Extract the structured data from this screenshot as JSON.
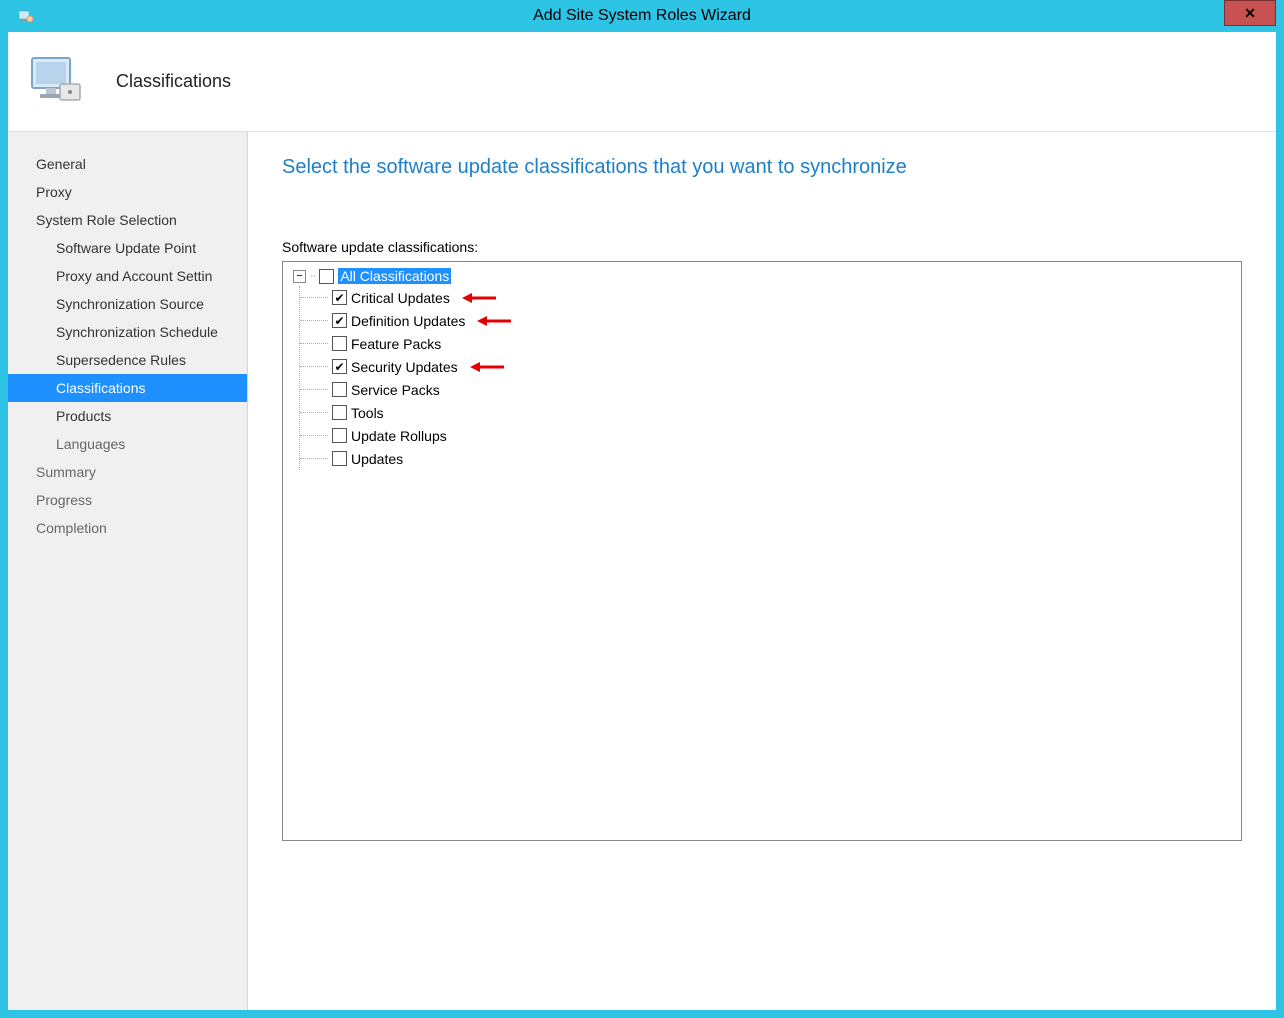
{
  "window": {
    "title": "Add Site System Roles Wizard"
  },
  "header": {
    "title": "Classifications"
  },
  "sidebar": {
    "items": [
      {
        "label": "General",
        "level": 0,
        "selected": false,
        "inactive": false
      },
      {
        "label": "Proxy",
        "level": 0,
        "selected": false,
        "inactive": false
      },
      {
        "label": "System Role Selection",
        "level": 0,
        "selected": false,
        "inactive": false
      },
      {
        "label": "Software Update Point",
        "level": 1,
        "selected": false,
        "inactive": false
      },
      {
        "label": "Proxy and Account Settin",
        "level": 1,
        "selected": false,
        "inactive": false
      },
      {
        "label": "Synchronization Source",
        "level": 1,
        "selected": false,
        "inactive": false
      },
      {
        "label": "Synchronization Schedule",
        "level": 1,
        "selected": false,
        "inactive": false
      },
      {
        "label": "Supersedence Rules",
        "level": 1,
        "selected": false,
        "inactive": false
      },
      {
        "label": "Classifications",
        "level": 1,
        "selected": true,
        "inactive": false
      },
      {
        "label": "Products",
        "level": 1,
        "selected": false,
        "inactive": false
      },
      {
        "label": "Languages",
        "level": 1,
        "selected": false,
        "inactive": true
      },
      {
        "label": "Summary",
        "level": 0,
        "selected": false,
        "inactive": true
      },
      {
        "label": "Progress",
        "level": 0,
        "selected": false,
        "inactive": true
      },
      {
        "label": "Completion",
        "level": 0,
        "selected": false,
        "inactive": true
      }
    ]
  },
  "main": {
    "heading": "Select the software update classifications that you want to synchronize",
    "tree_label": "Software update classifications:",
    "root": {
      "expander": "−",
      "label": "All Classifications",
      "checked": false,
      "highlighted": true
    },
    "children": [
      {
        "label": "Critical Updates",
        "checked": true,
        "arrow": true
      },
      {
        "label": "Definition Updates",
        "checked": true,
        "arrow": true
      },
      {
        "label": "Feature Packs",
        "checked": false,
        "arrow": false
      },
      {
        "label": "Security Updates",
        "checked": true,
        "arrow": true
      },
      {
        "label": "Service Packs",
        "checked": false,
        "arrow": false
      },
      {
        "label": "Tools",
        "checked": false,
        "arrow": false
      },
      {
        "label": "Update Rollups",
        "checked": false,
        "arrow": false
      },
      {
        "label": "Updates",
        "checked": false,
        "arrow": false
      }
    ]
  }
}
